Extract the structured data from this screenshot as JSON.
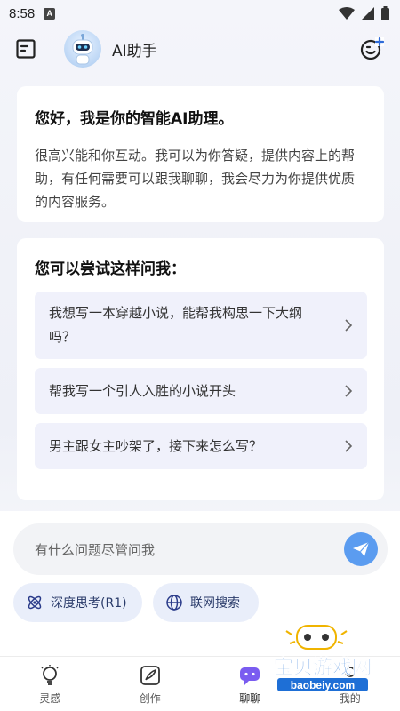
{
  "status_bar": {
    "time": "8:58",
    "a_badge": "A"
  },
  "header": {
    "title": "AI助手"
  },
  "welcome": {
    "heading": "您好，我是你的智能AI助理。",
    "body": "很高兴能和你互动。我可以为你答疑，提供内容上的帮助，有任何需要可以跟我聊聊，我会尽力为你提供优质的内容服务。"
  },
  "suggestions": {
    "heading": "您可以尝试这样问我：",
    "items": [
      {
        "text": "我想写一本穿越小说，能帮我构思一下大纲吗？"
      },
      {
        "text": "帮我写一个引人入胜的小说开头"
      },
      {
        "text": "男主跟女主吵架了，接下来怎么写？"
      }
    ]
  },
  "input": {
    "placeholder": "有什么问题尽管问我"
  },
  "chips": {
    "deep_think": "深度思考(R1)",
    "web_search": "联网搜索"
  },
  "tabs": [
    {
      "label": "灵感",
      "icon": "lightbulb-icon"
    },
    {
      "label": "创作",
      "icon": "quill-icon"
    },
    {
      "label": "聊聊",
      "icon": "chat-icon"
    },
    {
      "label": "我的",
      "icon": "person-icon"
    }
  ],
  "watermark": {
    "brand": "宝贝游戏网",
    "url": "baobeiy.com"
  },
  "colors": {
    "accent": "#5b9cf0",
    "chip_bg": "#e9eefa",
    "suggestion_bg": "#f0f1fb"
  }
}
